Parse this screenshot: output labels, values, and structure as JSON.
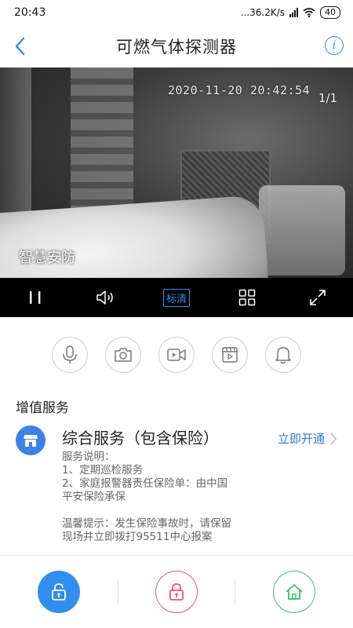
{
  "status": {
    "time": "20:43",
    "network_speed": "...36.2K/s",
    "battery": "40"
  },
  "header": {
    "title": "可燃气体探测器",
    "back_icon": "chevron-left-icon",
    "info_icon": "info-icon",
    "info_glyph": "i"
  },
  "video": {
    "timestamp": "2020-11-20 20:42:54",
    "page_indicator": "1/1",
    "watermark": "智慧安防"
  },
  "controls": {
    "pause_icon": "pause-icon",
    "volume_icon": "volume-icon",
    "quality_label": "标清",
    "layout_icon": "grid-icon",
    "fullscreen_icon": "fullscreen-icon"
  },
  "actions": [
    {
      "icon": "microphone-icon"
    },
    {
      "icon": "camera-icon"
    },
    {
      "icon": "video-record-icon"
    },
    {
      "icon": "playback-icon"
    },
    {
      "icon": "bell-icon"
    }
  ],
  "services": {
    "section_title": "增值服务",
    "name": "综合服务（包含保险）",
    "action_label": "立即开通",
    "desc_lines": [
      "服务说明：",
      "1、定期巡检服务",
      "2、家庭报警器责任保险单：由中国",
      "平安保险承保",
      "",
      "温馨提示：发生保险事故时，请保留",
      "现场并立即拨打95511中心报案"
    ]
  },
  "bottom_bar": [
    {
      "icon": "lock-disarm-icon",
      "color": "#2f8ef0"
    },
    {
      "icon": "lock-arm-icon",
      "color": "#e9537a"
    },
    {
      "icon": "home-icon",
      "color": "#3cbf6a"
    }
  ]
}
